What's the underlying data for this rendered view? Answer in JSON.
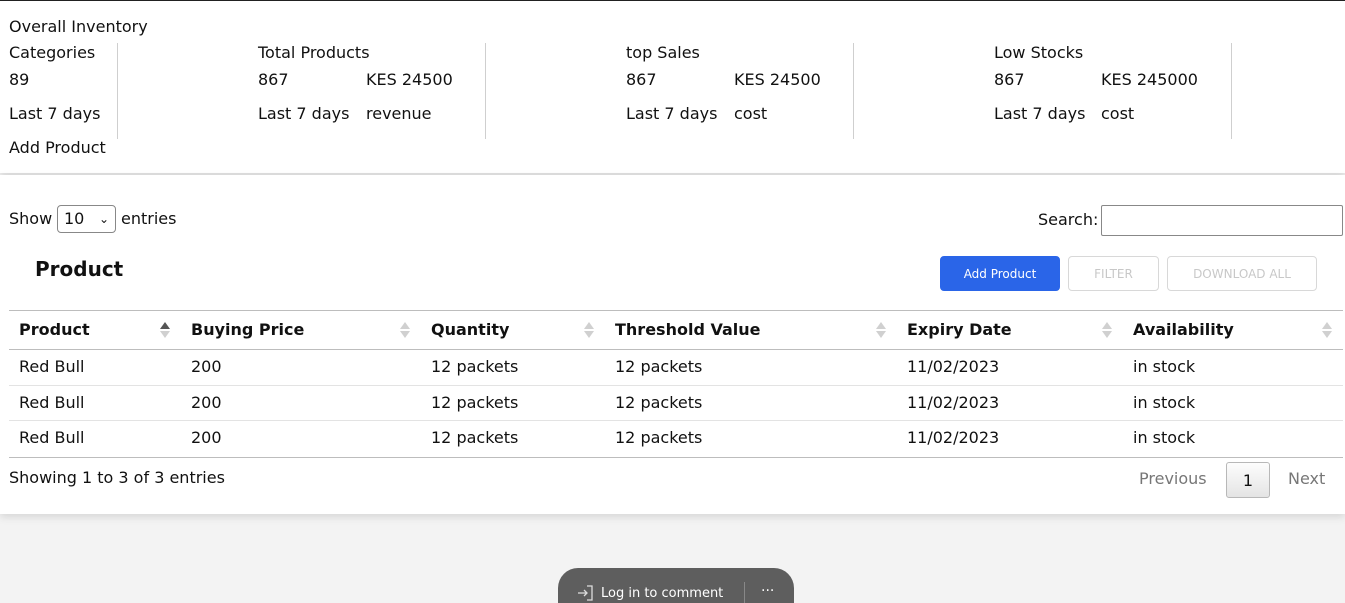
{
  "overview": {
    "title": "Overall Inventory",
    "categories": {
      "label": "Categories",
      "value": "89",
      "period": "Last 7 days",
      "action": "Add Product"
    },
    "total_products": {
      "label": "Total Products",
      "value": "867",
      "amount": "KES 24500",
      "period": "Last 7 days",
      "sub": "revenue"
    },
    "top_sales": {
      "label": "top Sales",
      "value": "867",
      "amount": "KES 24500",
      "period": "Last 7 days",
      "sub": "cost"
    },
    "low_stocks": {
      "label": "Low Stocks",
      "value": "867",
      "amount": "KES 245000",
      "period": "Last 7 days",
      "sub": "cost"
    }
  },
  "table_controls": {
    "show_label": "Show",
    "entries_value": "10",
    "entries_label": "entries",
    "search_label": "Search:",
    "search_value": ""
  },
  "products": {
    "title": "Product",
    "add_button": "Add Product",
    "filter_button": "FILTER",
    "download_button": "DOWNLOAD ALL"
  },
  "table": {
    "headers": [
      "Product",
      "Buying Price",
      "Quantity",
      "Threshold Value",
      "Expiry Date",
      "Availability"
    ],
    "rows": [
      [
        "Red Bull",
        "200",
        "12 packets",
        "12 packets",
        "11/02/2023",
        "in stock"
      ],
      [
        "Red Bull",
        "200",
        "12 packets",
        "12 packets",
        "11/02/2023",
        "in stock"
      ],
      [
        "Red Bull",
        "200",
        "12 packets",
        "12 packets",
        "11/02/2023",
        "in stock"
      ]
    ]
  },
  "pagination": {
    "info": "Showing 1 to 3 of 3 entries",
    "previous": "Previous",
    "current_page": "1",
    "next": "Next"
  },
  "comment_bar": {
    "login_text": "Log in to comment",
    "more": "···",
    "icon": "login-icon"
  },
  "colors": {
    "primary": "#2a65e8",
    "comment_bar": "#5e5e5e"
  }
}
